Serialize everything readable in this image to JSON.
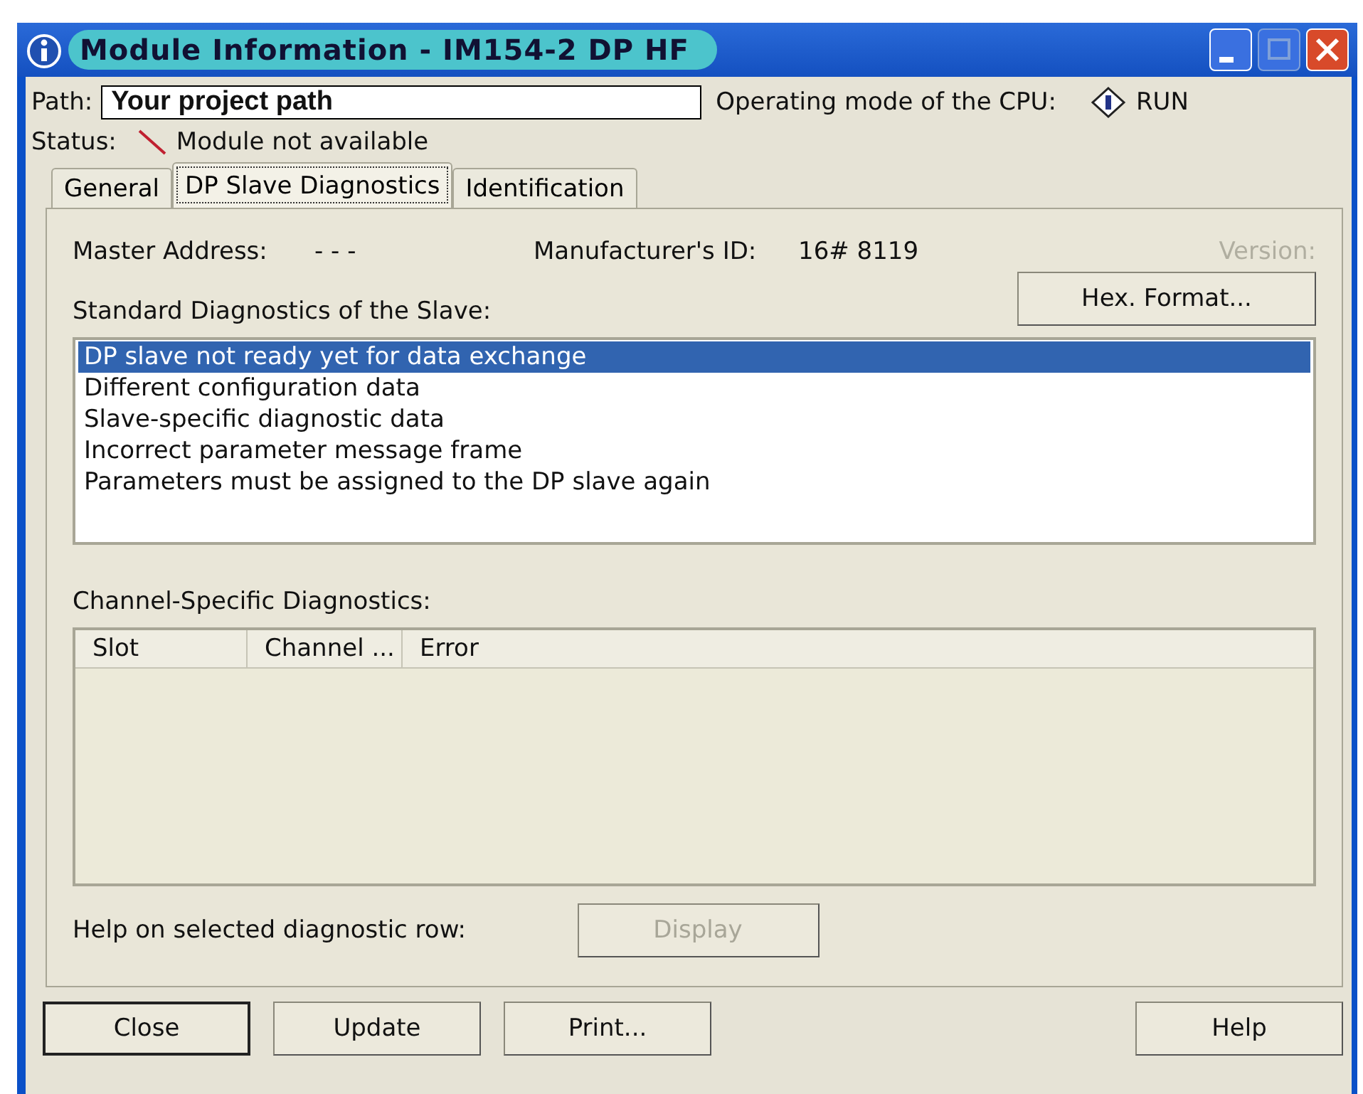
{
  "window": {
    "title": "Module Information - IM154-2 DP HF"
  },
  "path": {
    "label": "Path:",
    "value": "Your project path"
  },
  "operating_mode": {
    "label": "Operating mode of the  CPU:",
    "value": "RUN"
  },
  "status": {
    "label": "Status:",
    "value": "Module not available"
  },
  "tabs": [
    {
      "label": "General",
      "selected": false
    },
    {
      "label": "DP Slave Diagnostics",
      "selected": true
    },
    {
      "label": "Identification",
      "selected": false
    }
  ],
  "master_address": {
    "label": "Master Address:",
    "value": "- - -"
  },
  "manufacturer_id": {
    "label": "Manufacturer's ID:",
    "value": "16# 8119"
  },
  "version": {
    "label": "Version:",
    "disabled": true
  },
  "hex_button": {
    "label": "Hex. Format...",
    "disabled": false
  },
  "standard_diagnostics": {
    "label": "Standard Diagnostics of the Slave:",
    "items": [
      {
        "text": "DP slave not ready yet for data exchange",
        "selected": true
      },
      {
        "text": "Different configuration data",
        "selected": false
      },
      {
        "text": "Slave-specific diagnostic data",
        "selected": false
      },
      {
        "text": "Incorrect parameter message frame",
        "selected": false
      },
      {
        "text": "Parameters must be assigned to the DP slave again",
        "selected": false
      }
    ]
  },
  "channel_diagnostics": {
    "label": "Channel-Specific Diagnostics:",
    "columns": [
      "Slot",
      "Channel ...",
      "Error"
    ]
  },
  "help_row": {
    "label": "Help on selected diagnostic row:",
    "button": {
      "label": "Display",
      "disabled": true
    }
  },
  "buttons": [
    {
      "label": "Close",
      "default": true
    },
    {
      "label": "Update",
      "default": false
    },
    {
      "label": "Print...",
      "default": false
    },
    {
      "label": "Help",
      "default": false
    }
  ]
}
